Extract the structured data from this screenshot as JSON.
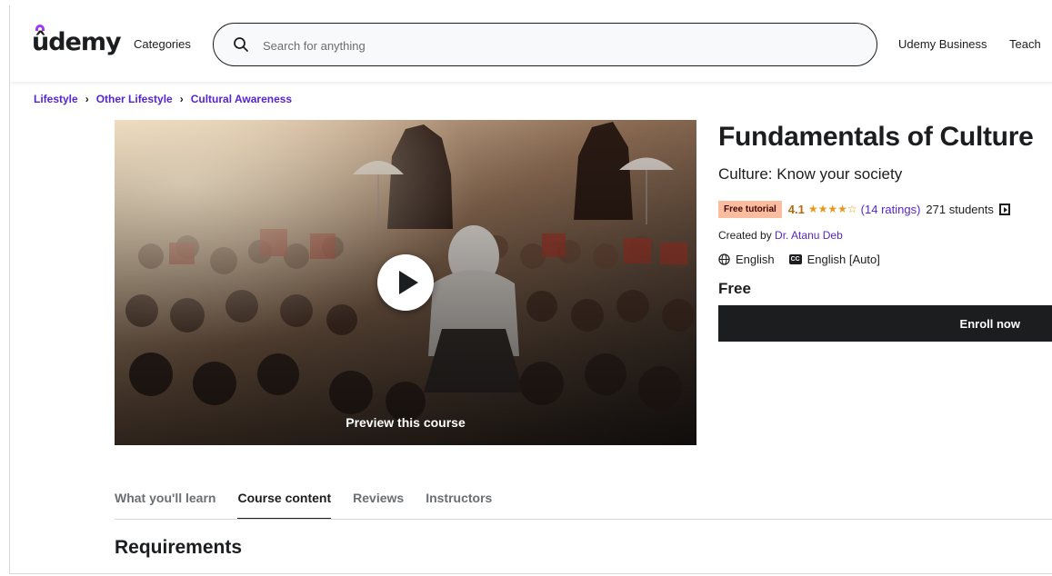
{
  "header": {
    "logo": "ûdemy",
    "categories_label": "Categories",
    "search_placeholder": "Search for anything",
    "business_label": "Udemy Business",
    "teach_label": "Teach"
  },
  "breadcrumb": [
    "Lifestyle",
    "Other Lifestyle",
    "Cultural Awareness"
  ],
  "preview": {
    "label": "Preview this course"
  },
  "course": {
    "title": "Fundamentals of Culture",
    "subtitle": "Culture: Know your society",
    "badge": "Free tutorial",
    "rating": "4.1",
    "stars": "★★★★☆",
    "ratings_count": "(14 ratings)",
    "students": "271 students",
    "created_by_label": "Created by",
    "instructor": "Dr. Atanu Deb",
    "language": "English",
    "captions": "English [Auto]",
    "price": "Free",
    "enroll_label": "Enroll now"
  },
  "tabs": [
    {
      "label": "What you'll learn",
      "active": false
    },
    {
      "label": "Course content",
      "active": true
    },
    {
      "label": "Reviews",
      "active": false
    },
    {
      "label": "Instructors",
      "active": false
    }
  ],
  "section_title": "Requirements",
  "colors": {
    "brand_purple": "#a435f0",
    "link_purple": "#5624d0",
    "badge_bg": "#fcbca0",
    "star_orange": "#e59819",
    "dark": "#1c1d1f"
  }
}
